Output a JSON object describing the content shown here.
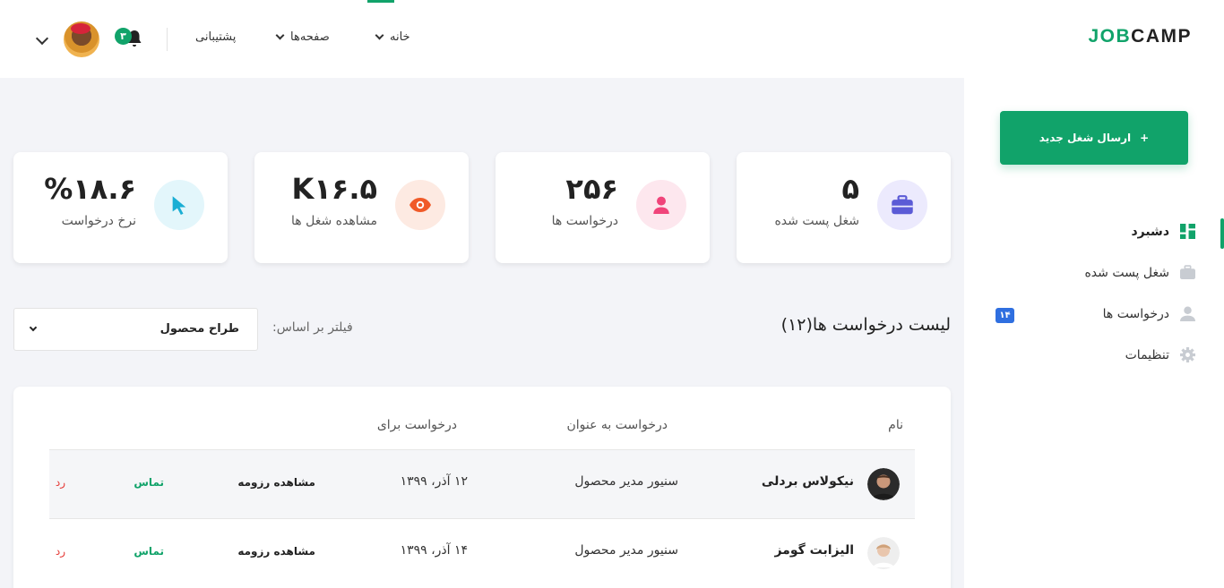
{
  "header": {
    "logo_part1": "JOB",
    "logo_part2": "CAMP",
    "nav": [
      {
        "label": "خانه"
      },
      {
        "label": "صفحه‌ها"
      },
      {
        "label": "پشتیبانی"
      }
    ],
    "notification_count": "۳"
  },
  "sidebar": {
    "new_job_button": "ارسال شغل جدید",
    "new_job_plus": "+",
    "items": [
      {
        "label": "دشبرد",
        "icon": "dashboard-icon",
        "active": true
      },
      {
        "label": "شغل پست شده",
        "icon": "briefcase-icon"
      },
      {
        "label": "درخواست ها",
        "icon": "user-icon",
        "badge": "۱۴"
      },
      {
        "label": "تنظیمات",
        "icon": "gear-icon"
      }
    ]
  },
  "stats": [
    {
      "value": "۵",
      "label": "شغل پست شده",
      "icon": "briefcase-icon",
      "color": "#5b5bd6",
      "bg": "#eceafd"
    },
    {
      "value": "۲۵۶",
      "label": "درخواست ها",
      "icon": "user-icon",
      "color": "#f0447a",
      "bg": "#fde7ee"
    },
    {
      "value": "K۱۶.۵",
      "label": "مشاهده شغل ها",
      "icon": "eye-icon",
      "color": "#f05a28",
      "bg": "#fdeae2"
    },
    {
      "value": "%۱۸.۶",
      "label": "نرخ درخواست",
      "icon": "cursor-icon",
      "color": "#1aaed4",
      "bg": "#e3f6fb"
    }
  ],
  "list": {
    "title": "لیست درخواست ها(۱۲)",
    "filter_label": "فیلتر بر اساس:",
    "filter_value": "طراح محصول"
  },
  "table": {
    "headers": {
      "name": "نام",
      "title": "درخواست به عنوان",
      "date": "درخواست برای"
    },
    "rows": [
      {
        "name": "نیکولاس بردلی",
        "title": "سنیور مدیر محصول",
        "date": "۱۲ آذر، ۱۳۹۹",
        "cv": "مشاهده رزومه",
        "contact": "تماس",
        "reject": "رد"
      },
      {
        "name": "الیزابت گومز",
        "title": "سنیور مدیر محصول",
        "date": "۱۴ آذر، ۱۳۹۹",
        "cv": "مشاهده رزومه",
        "contact": "تماس",
        "reject": "رد"
      }
    ]
  },
  "colors": {
    "accent": "#11a36a",
    "badge_blue": "#2f6fe0",
    "reject": "#e53935"
  }
}
